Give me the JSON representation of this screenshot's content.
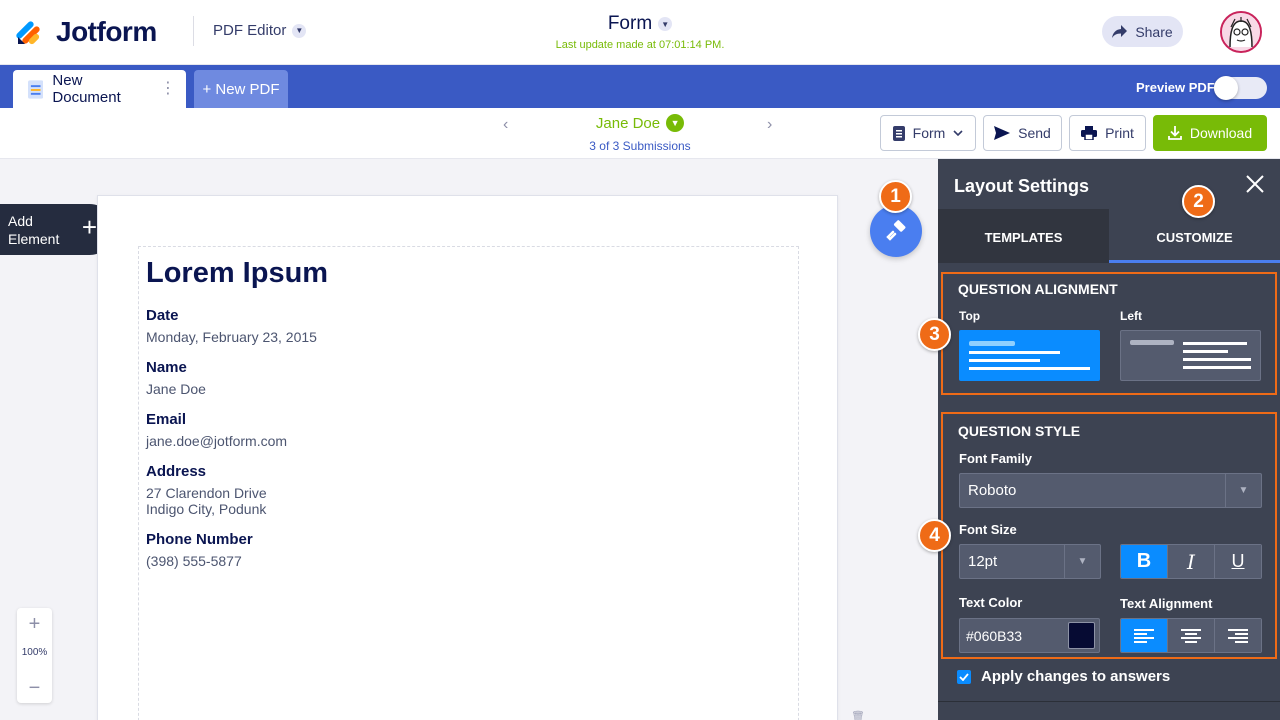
{
  "header": {
    "logo_text": "Jotform",
    "editor_switch": "PDF Editor",
    "form_title": "Form",
    "last_update": "Last update made at 07:01:14 PM.",
    "share_label": "Share",
    "brand_colors": {
      "navy": "#0a1551",
      "blue": "#3a5ac4",
      "green": "#78bb07",
      "orange": "#ef6b17"
    }
  },
  "tabs": {
    "document_tab": "New Document",
    "new_pdf": "+ New PDF",
    "preview_label": "Preview PDF",
    "preview_on": false
  },
  "toolbar": {
    "submitter": "Jane Doe",
    "submission_count": "3 of 3 Submissions",
    "form_btn": "Form",
    "send_btn": "Send",
    "print_btn": "Print",
    "download_btn": "Download"
  },
  "canvas": {
    "add_element_line1": "Add",
    "add_element_line2": "Element",
    "zoom_level": "100%"
  },
  "document": {
    "title": "Lorem Ipsum",
    "fields": [
      {
        "label": "Date",
        "value": "Monday, February 23, 2015"
      },
      {
        "label": "Name",
        "value": "Jane Doe"
      },
      {
        "label": "Email",
        "value": "jane.doe@jotform.com"
      },
      {
        "label": "Address",
        "value_line1": "27 Clarendon Drive",
        "value_line2": "Indigo City, Podunk"
      },
      {
        "label": "Phone Number",
        "value": "(398) 555-5877"
      }
    ]
  },
  "panel": {
    "title": "Layout Settings",
    "tabs": [
      "TEMPLATES",
      "CUSTOMIZE"
    ],
    "active_tab": "CUSTOMIZE",
    "question_alignment": {
      "title": "QUESTION ALIGNMENT",
      "options": [
        "Top",
        "Left"
      ],
      "selected": "Top"
    },
    "question_style": {
      "title": "QUESTION STYLE",
      "font_family_label": "Font Family",
      "font_family": "Roboto",
      "font_size_label": "Font Size",
      "font_size": "12pt",
      "bold_on": true,
      "text_color_label": "Text Color",
      "text_color": "#060B33",
      "text_alignment_label": "Text Alignment",
      "text_alignment": "left"
    },
    "apply_label": "Apply changes to answers",
    "apply_checked": true
  },
  "badges": [
    "1",
    "2",
    "3",
    "4"
  ]
}
